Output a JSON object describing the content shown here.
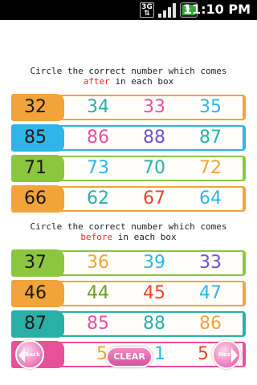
{
  "status_bar": {
    "network": "3G",
    "time": "11:10 PM"
  },
  "section_after": {
    "instruction_line1": "Circle the correct number which comes",
    "instruction_keyword": "after",
    "instruction_rest": "in each box",
    "rows": [
      {
        "number": "32",
        "options": [
          "34",
          "33",
          "35"
        ]
      },
      {
        "number": "85",
        "options": [
          "86",
          "88",
          "87"
        ]
      },
      {
        "number": "71",
        "options": [
          "73",
          "70",
          "72"
        ]
      },
      {
        "number": "66",
        "options": [
          "62",
          "67",
          "64"
        ]
      }
    ]
  },
  "section_before": {
    "instruction_line1": "Circle the correct number which comes",
    "instruction_keyword": "before",
    "instruction_rest": "in each box",
    "rows": [
      {
        "number": "37",
        "options": [
          "36",
          "39",
          "33"
        ]
      },
      {
        "number": "46",
        "options": [
          "44",
          "45",
          "47"
        ]
      },
      {
        "number": "87",
        "options": [
          "85",
          "88",
          "86"
        ]
      },
      {
        "number": "",
        "options": [
          "5",
          "1",
          "5"
        ]
      }
    ]
  },
  "buttons": {
    "back": "Back",
    "clear": "CLEAR",
    "next": "Next"
  },
  "colors": {
    "orange": "#f2a33a",
    "blue": "#2fb5e8",
    "green": "#8cc63f",
    "teal": "#29b0a6",
    "pink": "#e94f9b",
    "purple": "#6a56c4",
    "red": "#e8462c",
    "olive": "#6e9e2a",
    "keyword": "#e0301e"
  }
}
